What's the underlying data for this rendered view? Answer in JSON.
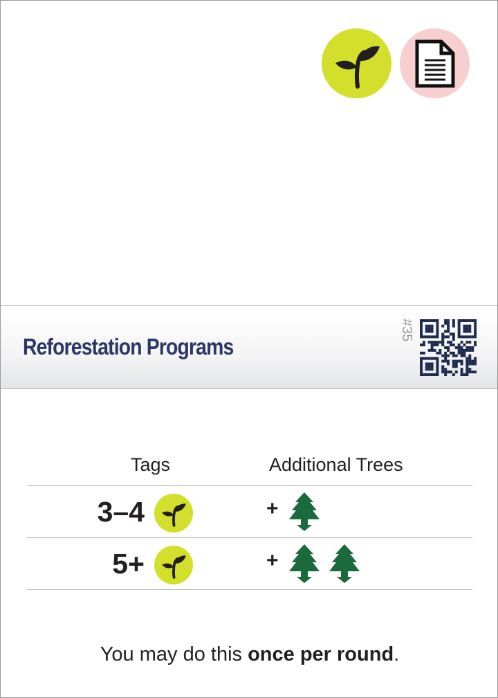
{
  "colors": {
    "accent_green": "#d4df2c",
    "pink": "#f7cfd0",
    "tree_green": "#1a6a3a",
    "title_navy": "#2c3766"
  },
  "top_icons": [
    {
      "name": "sprout-icon",
      "background": "#d4df2c"
    },
    {
      "name": "document-icon",
      "background": "#f7cfd0"
    }
  ],
  "card": {
    "title": "Reforestation Programs",
    "number": "#35",
    "qr_code": "qr-code-icon"
  },
  "table": {
    "headers": [
      "Tags",
      "Additional Trees"
    ],
    "rows": [
      {
        "tags": "3–4",
        "tag_icon": "sprout-icon",
        "plus": "+",
        "trees": 1
      },
      {
        "tags": "5+",
        "tag_icon": "sprout-icon",
        "plus": "+",
        "trees": 2
      }
    ]
  },
  "footer": {
    "prefix": "You may do this ",
    "bold": "once per round",
    "suffix": "."
  }
}
